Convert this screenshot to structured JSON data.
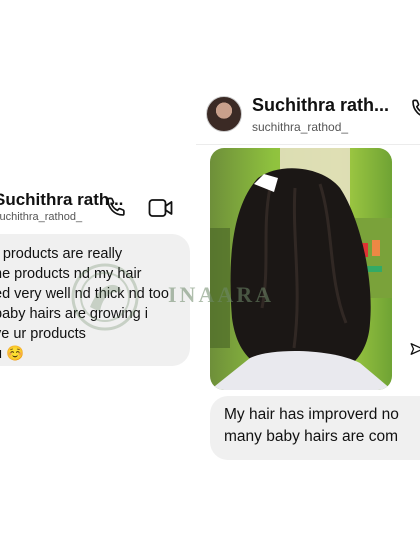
{
  "left_chat": {
    "contact_name": "Suchithra rath...",
    "contact_handle": "suchithra_rathod_",
    "message_lines": [
      "r products are really",
      "he products nd my hair",
      "ed very well nd thick nd too",
      "baby hairs are growing i",
      "ve ur products",
      "u ☺️"
    ]
  },
  "right_chat": {
    "contact_name": "Suchithra rath...",
    "contact_handle": "suchithra_rathod_",
    "message_lines": [
      "My hair has improverd no",
      "many baby hairs are com"
    ]
  },
  "watermark": {
    "text": "INAARA"
  },
  "icons": [
    "phone-icon",
    "video-camera-icon",
    "share-icon",
    "avatar"
  ],
  "colors": {
    "bubble": "#f0f0f0",
    "text": "#111111",
    "handle": "#555555"
  }
}
